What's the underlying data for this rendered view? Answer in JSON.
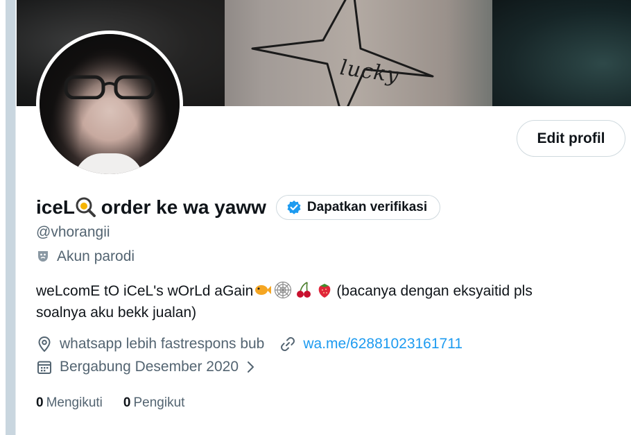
{
  "banner": {
    "handwriting": "lucky"
  },
  "profile": {
    "display_name": "iceL",
    "display_name_suffix": " order ke wa yaww",
    "name_emoji": "magnifier-egg-icon",
    "handle": "@vhorangii",
    "parody_label": "Akun parodi",
    "bio_line1_a": "weLcomE tO iCeL's wOrLd aGain",
    "bio_line1_b": "(bacanya dengan eksyaitid pls",
    "bio_line2": "soalnya aku bekk jualan)",
    "location": "whatsapp lebih fastrespons bub",
    "website": "wa.me/62881023161711",
    "joined": "Bergabung Desember 2020"
  },
  "buttons": {
    "edit_profile": "Edit profil",
    "get_verified": "Dapatkan verifikasi"
  },
  "stats": {
    "following_count": "0",
    "following_label": "Mengikuti",
    "followers_count": "0",
    "followers_label": "Pengikut"
  },
  "colors": {
    "link": "#1d9bf0",
    "secondary_text": "#536471",
    "verified_badge": "#1d9bf0"
  }
}
